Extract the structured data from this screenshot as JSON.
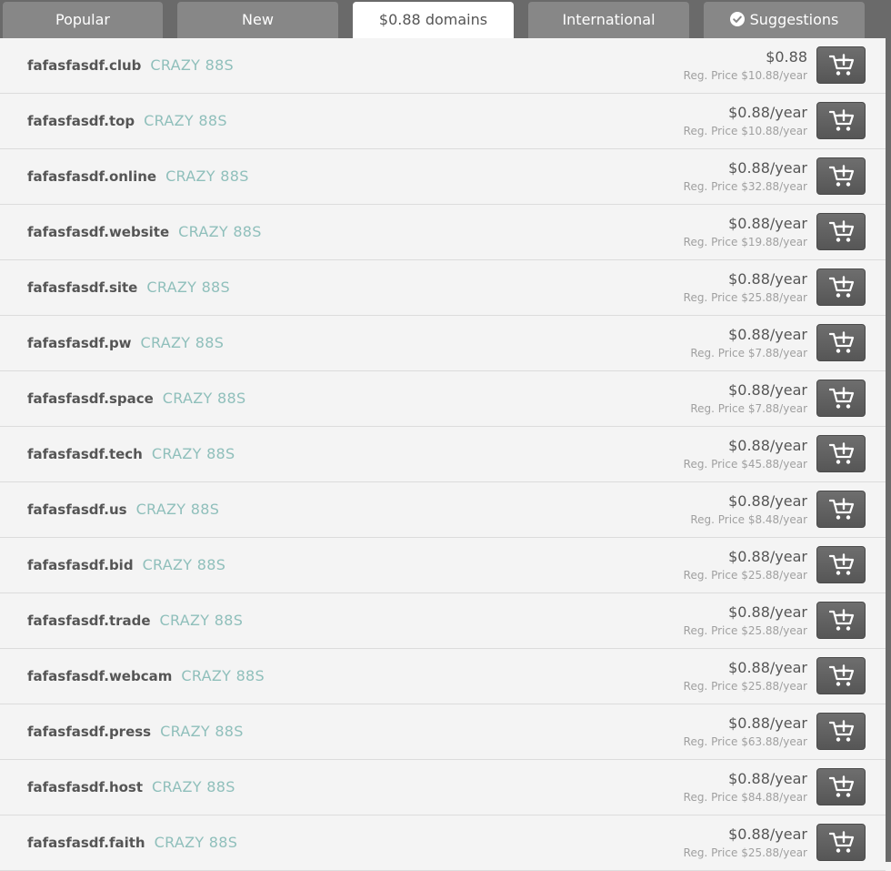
{
  "tabs": [
    {
      "label": "Popular",
      "active": false
    },
    {
      "label": "New",
      "active": false
    },
    {
      "label": "$0.88 domains",
      "active": true
    },
    {
      "label": "International",
      "active": false
    },
    {
      "label": "Suggestions",
      "active": false,
      "icon": "check-circle-icon"
    }
  ],
  "results": [
    {
      "name": "fafasfasdf.club",
      "badge": "CRAZY 88S",
      "price": "$0.88",
      "reg_price": "Reg. Price $10.88/year"
    },
    {
      "name": "fafasfasdf.top",
      "badge": "CRAZY 88S",
      "price": "$0.88/year",
      "reg_price": "Reg. Price $10.88/year"
    },
    {
      "name": "fafasfasdf.online",
      "badge": "CRAZY 88S",
      "price": "$0.88/year",
      "reg_price": "Reg. Price $32.88/year"
    },
    {
      "name": "fafasfasdf.website",
      "badge": "CRAZY 88S",
      "price": "$0.88/year",
      "reg_price": "Reg. Price $19.88/year"
    },
    {
      "name": "fafasfasdf.site",
      "badge": "CRAZY 88S",
      "price": "$0.88/year",
      "reg_price": "Reg. Price $25.88/year"
    },
    {
      "name": "fafasfasdf.pw",
      "badge": "CRAZY 88S",
      "price": "$0.88/year",
      "reg_price": "Reg. Price $7.88/year"
    },
    {
      "name": "fafasfasdf.space",
      "badge": "CRAZY 88S",
      "price": "$0.88/year",
      "reg_price": "Reg. Price $7.88/year"
    },
    {
      "name": "fafasfasdf.tech",
      "badge": "CRAZY 88S",
      "price": "$0.88/year",
      "reg_price": "Reg. Price $45.88/year"
    },
    {
      "name": "fafasfasdf.us",
      "badge": "CRAZY 88S",
      "price": "$0.88/year",
      "reg_price": "Reg. Price $8.48/year"
    },
    {
      "name": "fafasfasdf.bid",
      "badge": "CRAZY 88S",
      "price": "$0.88/year",
      "reg_price": "Reg. Price $25.88/year"
    },
    {
      "name": "fafasfasdf.trade",
      "badge": "CRAZY 88S",
      "price": "$0.88/year",
      "reg_price": "Reg. Price $25.88/year"
    },
    {
      "name": "fafasfasdf.webcam",
      "badge": "CRAZY 88S",
      "price": "$0.88/year",
      "reg_price": "Reg. Price $25.88/year"
    },
    {
      "name": "fafasfasdf.press",
      "badge": "CRAZY 88S",
      "price": "$0.88/year",
      "reg_price": "Reg. Price $63.88/year"
    },
    {
      "name": "fafasfasdf.host",
      "badge": "CRAZY 88S",
      "price": "$0.88/year",
      "reg_price": "Reg. Price $84.88/year"
    },
    {
      "name": "fafasfasdf.faith",
      "badge": "CRAZY 88S",
      "price": "$0.88/year",
      "reg_price": "Reg. Price $25.88/year"
    }
  ],
  "icons": {
    "cart": "add-to-cart-icon",
    "check": "check-circle-icon"
  },
  "colors": {
    "tab_bg": "#878787",
    "tab_active_bg": "#ffffff",
    "badge": "#8fbfbb",
    "cart_button": "#5f5f5f"
  }
}
